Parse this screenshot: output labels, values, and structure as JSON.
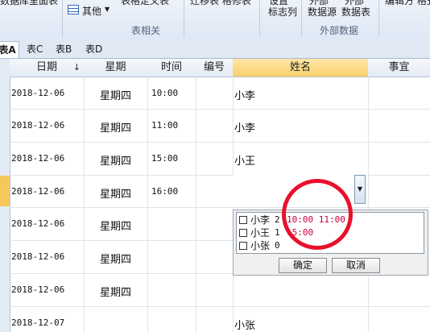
{
  "ribbon": {
    "top_texts": [
      "数据库",
      "里面表",
      "表格定义表",
      "迁移表 格修表",
      "设置",
      "外部 ",
      "外部",
      "编辑方 格式"
    ],
    "other_label": "其他",
    "biaozhi_label": "标志列",
    "ext_source_label": "数据源",
    "ext_table_label": "数据表",
    "group_table": "表相关",
    "group_external": "外部数据"
  },
  "tabs": [
    "表A",
    "表C",
    "表B",
    "表D"
  ],
  "columns": {
    "date": "日期",
    "weekday": "星期",
    "time": "时间",
    "number": "编号",
    "name": "姓名",
    "matter": "事宜"
  },
  "rows": [
    {
      "date": "2018-12-06",
      "weekday": "星期四",
      "time": "10:00",
      "name": "小李"
    },
    {
      "date": "2018-12-06",
      "weekday": "星期四",
      "time": "11:00",
      "name": "小李"
    },
    {
      "date": "2018-12-06",
      "weekday": "星期四",
      "time": "15:00",
      "name": "小王"
    },
    {
      "date": "2018-12-06",
      "weekday": "星期四",
      "time": "16:00",
      "name": ""
    },
    {
      "date": "2018-12-06",
      "weekday": "星期四",
      "time": "",
      "name": ""
    },
    {
      "date": "2018-12-06",
      "weekday": "星期四",
      "time": "",
      "name": ""
    },
    {
      "date": "2018-12-06",
      "weekday": "星期四",
      "time": "",
      "name": ""
    },
    {
      "date": "2018-12-07",
      "weekday": "",
      "time": "",
      "name": "小张"
    }
  ],
  "dropdown": {
    "items": [
      {
        "name": "小李",
        "count": "2",
        "times": "10:00  11:00"
      },
      {
        "name": "小王",
        "count": "1",
        "times": "15:00"
      },
      {
        "name": "小张",
        "count": "0",
        "times": ""
      }
    ],
    "ok_label": "确定",
    "cancel_label": "取消",
    "arrow_icon": "chevron-down-icon"
  },
  "colors": {
    "header_selected": "#f8cf6e",
    "time_highlight": "#c8003c",
    "annotation_circle": "#e8112d"
  }
}
